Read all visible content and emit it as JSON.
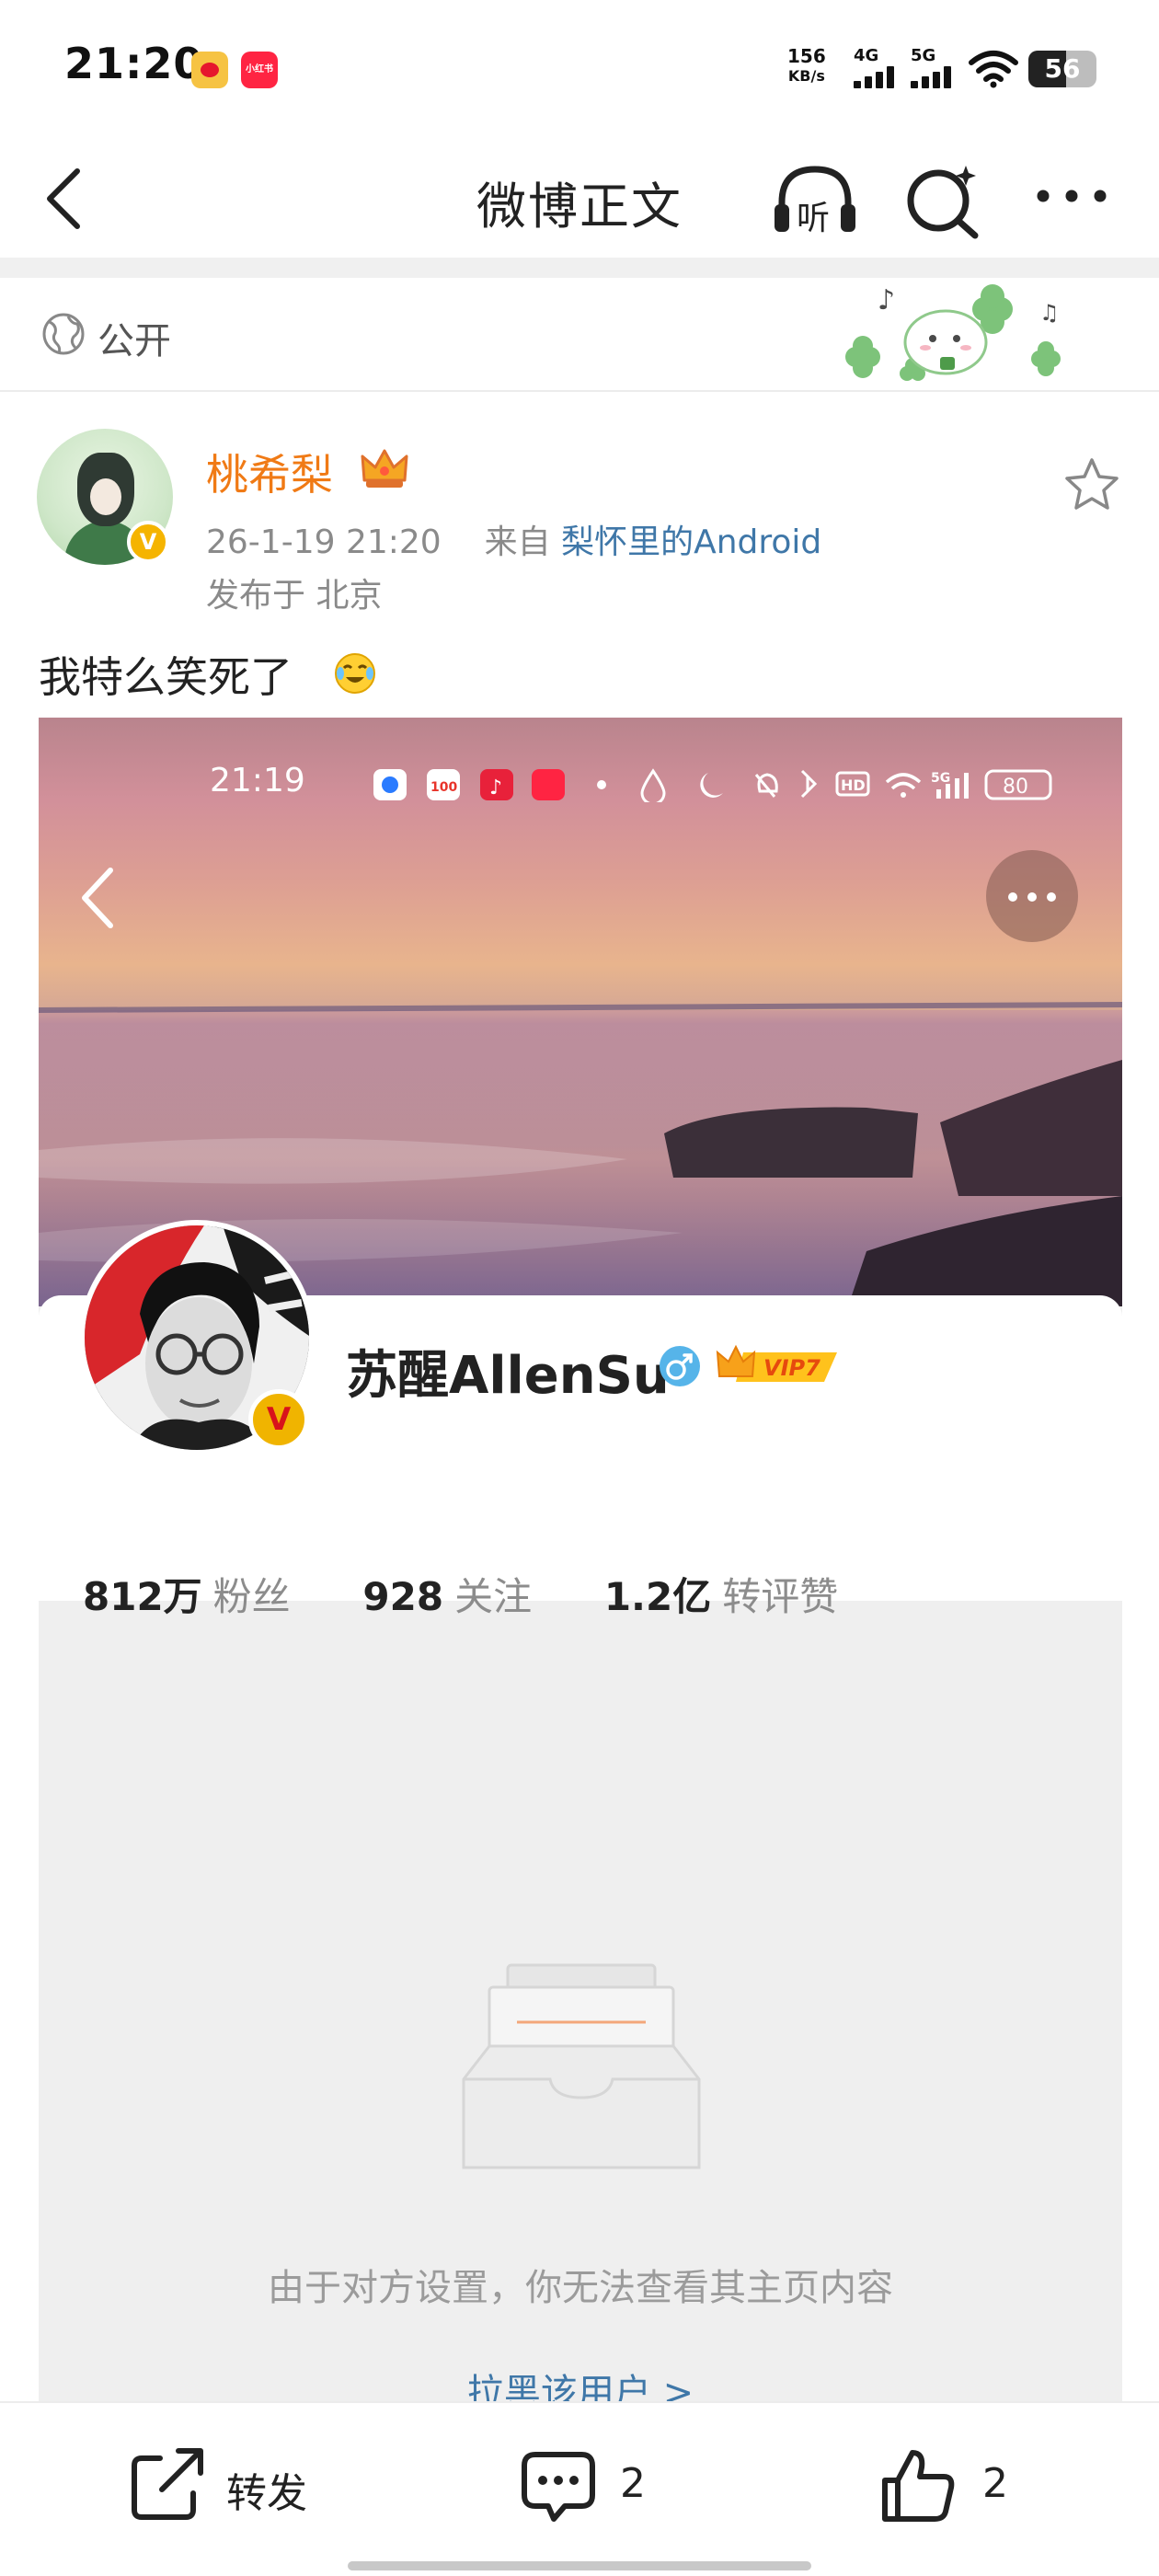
{
  "status_bar": {
    "time": "21:20",
    "app_icons": [
      "weibo-icon",
      "xiaohongshu-icon"
    ],
    "xhs_label": "小红书",
    "net_speed": "156",
    "net_unit": "KB/s",
    "signal1": "4G",
    "signal2": "5G",
    "battery": "56",
    "battery_level": 0.56
  },
  "nav": {
    "title": "微博正文",
    "icons": [
      "back-icon",
      "listen-icon",
      "search-icon",
      "more-icon"
    ],
    "listen_label": "听"
  },
  "privacy": {
    "label": "公开",
    "icon": "globe-icon"
  },
  "post": {
    "author": "桃希梨",
    "date": "26-1-19 21:20",
    "from_prefix": "来自",
    "source": "梨怀里的Android",
    "location": "发布于 北京",
    "text": "我特么笑死了",
    "verified_mark": "V"
  },
  "embedded_screenshot": {
    "status_time": "21:19",
    "battery": "80",
    "profile_name": "苏醒AllenSu",
    "vip_label": "VIP7",
    "verified_mark": "V",
    "stats": [
      {
        "value": "812万",
        "label": "粉丝"
      },
      {
        "value": "928",
        "label": "关注"
      },
      {
        "value": "1.2亿",
        "label": "转评赞"
      }
    ],
    "blocked_message": "由于对方设置，你无法查看其主页内容",
    "block_link": "拉黑该用户 >"
  },
  "toolbar": {
    "repost_label": "转发",
    "comment_count": "2",
    "like_count": "2"
  },
  "colors": {
    "author_orange": "#f07a15",
    "link_blue": "#3f77a8",
    "muted_gray": "#8a8a8a",
    "verified_yellow": "#f5b400"
  }
}
